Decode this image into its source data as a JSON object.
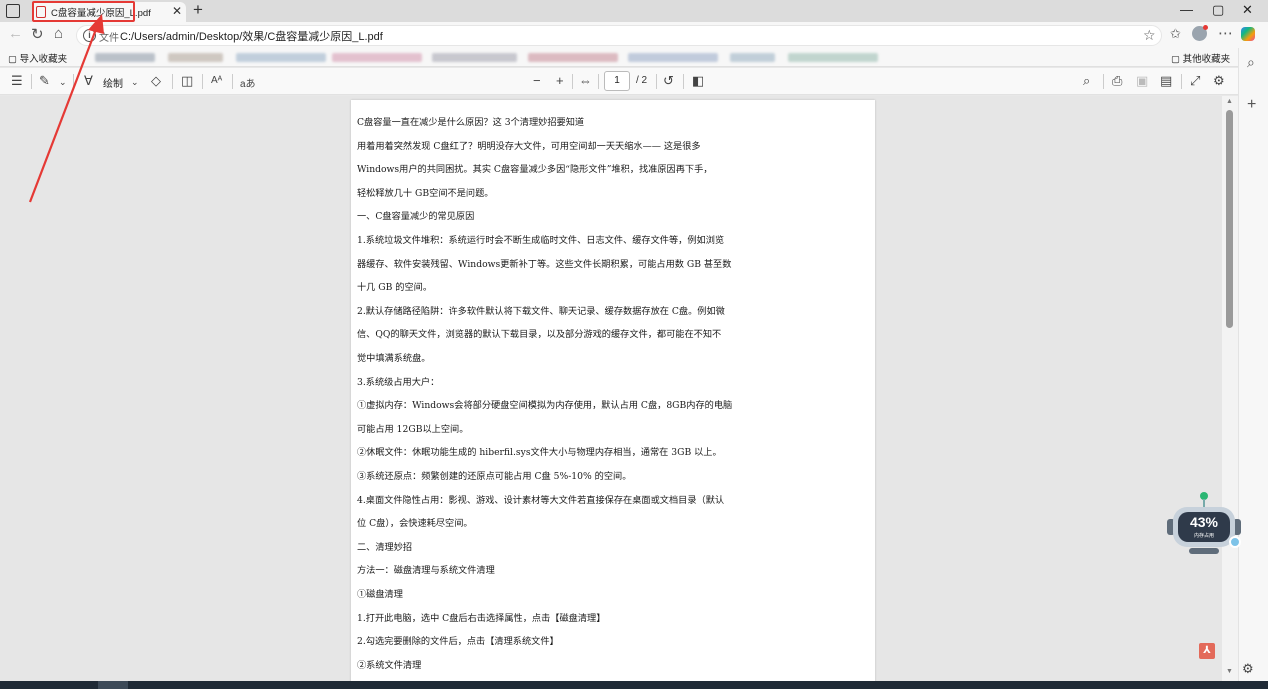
{
  "browser": {
    "tab": {
      "title": "C盘容量减少原因_L.pdf",
      "close": "✕"
    },
    "new_tab": "+",
    "window_controls": {
      "minimize": "—",
      "maximize": "▢",
      "close": "✕"
    },
    "address": {
      "prefix": "文件",
      "url": "C:/Users/admin/Desktop/效果/C盘容量减少原因_L.pdf"
    },
    "favorites": {
      "import_label": "导入收藏夹",
      "other_label": "其他收藏夹"
    }
  },
  "pdf_toolbar": {
    "draw_label": "绘制",
    "text_size_label": "Aᴬ",
    "read_aloud_label": "aあ",
    "zoom_out": "−",
    "zoom_in": "+",
    "current_page": "1",
    "total_pages": "/ 2"
  },
  "memory_widget": {
    "percent": "43%",
    "label": "内存占用"
  },
  "document": {
    "lines": [
      "C盘容量一直在减少是什么原因？这 3个清理妙招要知道",
      "用着用着突然发现 C盘红了？明明没存大文件，可用空间却一天天缩水—— 这是很多",
      "Windows用户的共同困扰。其实 C盘容量减少多因“隐形文件”堆积，找准原因再下手，",
      "轻松释放几十 GB空间不是问题。",
      "一、C盘容量减少的常见原因",
      "1.系统垃圾文件堆积：系统运行时会不断生成临时文件、日志文件、缓存文件等，例如浏览",
      "器缓存、软件安装残留、Windows更新补丁等。这些文件长期积累，可能占用数 GB 甚至数",
      "十几 GB 的空间。",
      "2.默认存储路径陷阱：许多软件默认将下载文件、聊天记录、缓存数据存放在 C盘。例如微",
      "信、QQ的聊天文件，浏览器的默认下载目录，以及部分游戏的缓存文件，都可能在不知不",
      "觉中填满系统盘。",
      "3.系统级占用大户：",
      "①虚拟内存：Windows会将部分硬盘空间模拟为内存使用，默认占用 C盘，8GB内存的电脑",
      "可能占用 12GB以上空间。",
      "②休眠文件：休眠功能生成的 hiberfil.sys文件大小与物理内存相当，通常在 3GB 以上。",
      "③系统还原点：频繁创建的还原点可能占用 C盘 5%-10% 的空间。",
      "4.桌面文件隐性占用：影视、游戏、设计素材等大文件若直接保存在桌面或文档目录（默认",
      "位 C盘），会快速耗尽空间。",
      "二、清理妙招",
      "方法一：磁盘清理与系统文件清理",
      "①磁盘清理",
      "1.打开此电脑，选中 C盘后右击选择属性，点击【磁盘清理】",
      "2.勾选完要删除的文件后，点击【清理系统文件】",
      "②系统文件清理"
    ]
  }
}
